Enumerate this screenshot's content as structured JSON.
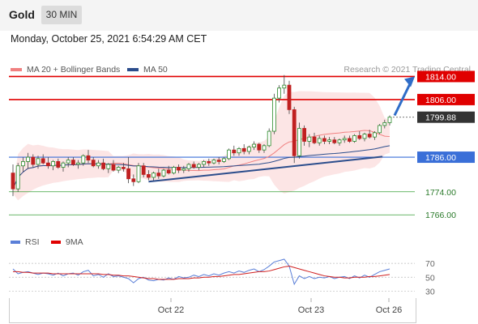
{
  "header": {
    "title": "Gold",
    "timeframe": "30 MIN"
  },
  "datetime": "Monday, October 25, 2021 6:54:29 AM CET",
  "legend": [
    {
      "label": "MA 20 + Bollinger Bands",
      "color": "#f08080"
    },
    {
      "label": "MA 50",
      "color": "#2b4d8c"
    }
  ],
  "credit": "Research © 2021 Trading Central",
  "colors": {
    "resistance": "#e00000",
    "support_blue": "#3a6fd8",
    "support_green": "#38a038",
    "candle_up": "#2a8a2a",
    "candle_down": "#c02020",
    "trend": "#2b4d8c",
    "last": "#333333"
  },
  "chart_data": {
    "type": "candlestick",
    "price_ylim": [
      1761,
      1822
    ],
    "levels": [
      {
        "value": 1814.0,
        "label": "1814.00",
        "kind": "resistance"
      },
      {
        "value": 1806.0,
        "label": "1806.00",
        "kind": "resistance"
      },
      {
        "value": 1799.88,
        "label": "1799.88",
        "kind": "last"
      },
      {
        "value": 1786.0,
        "label": "1786.00",
        "kind": "pivot"
      },
      {
        "value": 1774.0,
        "label": "1774.00",
        "kind": "support"
      },
      {
        "value": 1766.0,
        "label": "1766.00",
        "kind": "support"
      }
    ],
    "x_ticks": [
      "Oct 22",
      "Oct 23",
      "Oct 26"
    ],
    "candles": [
      [
        1780.5,
        1783.5,
        1772.5,
        1775.0
      ],
      [
        1775.0,
        1784.0,
        1774.0,
        1783.0
      ],
      [
        1783.0,
        1786.0,
        1781.0,
        1784.5
      ],
      [
        1784.5,
        1787.5,
        1782.0,
        1786.0
      ],
      [
        1786.0,
        1787.0,
        1782.5,
        1783.5
      ],
      [
        1783.5,
        1786.5,
        1782.0,
        1785.5
      ],
      [
        1785.5,
        1787.0,
        1783.5,
        1784.0
      ],
      [
        1784.0,
        1786.0,
        1782.0,
        1783.0
      ],
      [
        1783.0,
        1785.0,
        1781.5,
        1784.5
      ],
      [
        1784.5,
        1785.5,
        1782.0,
        1782.5
      ],
      [
        1782.5,
        1784.5,
        1781.0,
        1784.0
      ],
      [
        1784.0,
        1786.0,
        1782.5,
        1785.0
      ],
      [
        1785.0,
        1786.0,
        1783.0,
        1783.5
      ],
      [
        1783.5,
        1785.0,
        1782.0,
        1784.0
      ],
      [
        1784.0,
        1787.0,
        1783.0,
        1786.5
      ],
      [
        1786.5,
        1788.5,
        1784.0,
        1785.0
      ],
      [
        1785.0,
        1786.0,
        1782.5,
        1783.0
      ],
      [
        1783.0,
        1785.0,
        1782.0,
        1784.0
      ],
      [
        1784.0,
        1785.5,
        1781.5,
        1782.0
      ],
      [
        1782.0,
        1784.0,
        1780.5,
        1783.5
      ],
      [
        1783.5,
        1785.0,
        1781.0,
        1781.5
      ],
      [
        1781.5,
        1783.0,
        1780.5,
        1782.5
      ],
      [
        1782.5,
        1784.0,
        1781.0,
        1782.0
      ],
      [
        1782.0,
        1786.0,
        1777.0,
        1778.5
      ],
      [
        1778.5,
        1780.0,
        1776.0,
        1777.5
      ],
      [
        1777.5,
        1784.0,
        1777.0,
        1783.0
      ],
      [
        1783.0,
        1784.0,
        1779.0,
        1780.0
      ],
      [
        1780.0,
        1781.5,
        1778.0,
        1779.0
      ],
      [
        1779.0,
        1781.0,
        1777.5,
        1780.5
      ],
      [
        1780.5,
        1782.0,
        1778.5,
        1779.5
      ],
      [
        1779.5,
        1782.0,
        1779.0,
        1781.5
      ],
      [
        1781.5,
        1783.0,
        1780.0,
        1780.5
      ],
      [
        1780.5,
        1783.0,
        1780.0,
        1782.5
      ],
      [
        1782.5,
        1783.5,
        1780.5,
        1781.5
      ],
      [
        1781.5,
        1783.0,
        1780.5,
        1782.0
      ],
      [
        1782.0,
        1784.0,
        1781.0,
        1783.5
      ],
      [
        1783.5,
        1784.5,
        1782.0,
        1782.5
      ],
      [
        1782.5,
        1784.0,
        1781.5,
        1783.5
      ],
      [
        1783.5,
        1785.0,
        1782.5,
        1784.5
      ],
      [
        1784.5,
        1785.5,
        1783.0,
        1784.0
      ],
      [
        1784.0,
        1785.5,
        1783.5,
        1785.0
      ],
      [
        1785.0,
        1786.0,
        1783.5,
        1784.5
      ],
      [
        1784.5,
        1786.0,
        1784.0,
        1785.5
      ],
      [
        1785.5,
        1789.0,
        1785.0,
        1788.5
      ],
      [
        1788.5,
        1790.0,
        1786.5,
        1787.5
      ],
      [
        1787.5,
        1789.5,
        1786.5,
        1789.0
      ],
      [
        1789.0,
        1790.5,
        1787.0,
        1788.0
      ],
      [
        1788.0,
        1790.0,
        1787.0,
        1789.5
      ],
      [
        1789.5,
        1791.5,
        1788.5,
        1790.5
      ],
      [
        1790.5,
        1791.0,
        1787.5,
        1788.5
      ],
      [
        1788.5,
        1790.5,
        1787.5,
        1790.0
      ],
      [
        1790.0,
        1796.0,
        1789.5,
        1795.0
      ],
      [
        1795.0,
        1808.0,
        1794.0,
        1806.5
      ],
      [
        1806.5,
        1811.0,
        1805.0,
        1810.0
      ],
      [
        1810.0,
        1814.5,
        1808.0,
        1811.0
      ],
      [
        1811.0,
        1812.5,
        1801.0,
        1802.5
      ],
      [
        1802.5,
        1803.5,
        1784.0,
        1786.5
      ],
      [
        1786.5,
        1798.0,
        1785.5,
        1796.0
      ],
      [
        1796.0,
        1797.0,
        1790.0,
        1791.5
      ],
      [
        1791.5,
        1794.0,
        1789.5,
        1793.0
      ],
      [
        1793.0,
        1794.5,
        1790.5,
        1791.0
      ],
      [
        1791.0,
        1793.5,
        1790.0,
        1792.5
      ],
      [
        1792.5,
        1793.5,
        1790.5,
        1791.5
      ],
      [
        1791.5,
        1793.0,
        1790.5,
        1792.0
      ],
      [
        1792.0,
        1793.0,
        1790.5,
        1791.0
      ],
      [
        1791.0,
        1792.5,
        1790.0,
        1792.0
      ],
      [
        1792.0,
        1793.5,
        1791.0,
        1792.5
      ],
      [
        1792.5,
        1793.5,
        1791.0,
        1791.5
      ],
      [
        1791.5,
        1794.0,
        1791.0,
        1793.5
      ],
      [
        1793.5,
        1795.0,
        1792.0,
        1792.5
      ],
      [
        1792.5,
        1794.5,
        1791.5,
        1794.0
      ],
      [
        1794.0,
        1795.5,
        1792.5,
        1793.0
      ],
      [
        1793.0,
        1795.0,
        1792.0,
        1794.5
      ],
      [
        1794.5,
        1797.5,
        1794.0,
        1797.0
      ],
      [
        1797.0,
        1799.0,
        1796.0,
        1798.0
      ],
      [
        1798.0,
        1800.5,
        1797.0,
        1799.88
      ]
    ],
    "rsi": {
      "label": "RSI",
      "ma_label": "9MA",
      "ylim": [
        20,
        90
      ],
      "ticks": [
        70,
        50,
        30
      ],
      "values": [
        62,
        55,
        57,
        58,
        56,
        54,
        56,
        55,
        53,
        56,
        52,
        55,
        56,
        53,
        58,
        60,
        52,
        54,
        50,
        55,
        51,
        52,
        50,
        48,
        42,
        48,
        50,
        46,
        45,
        47,
        46,
        49,
        47,
        51,
        49,
        50,
        53,
        51,
        54,
        52,
        55,
        53,
        56,
        58,
        56,
        59,
        57,
        60,
        62,
        58,
        61,
        66,
        72,
        74,
        76,
        66,
        40,
        52,
        48,
        51,
        48,
        50,
        49,
        51,
        48,
        50,
        51,
        48,
        52,
        49,
        53,
        50,
        54,
        58,
        60,
        62
      ],
      "ma": [
        58,
        58,
        57,
        57,
        56,
        56,
        56,
        56,
        55,
        55,
        55,
        55,
        55,
        55,
        55,
        55,
        55,
        55,
        54,
        54,
        53,
        53,
        52,
        52,
        51,
        50,
        49,
        48,
        48,
        47,
        47,
        47,
        47,
        48,
        48,
        48,
        49,
        49,
        50,
        50,
        51,
        51,
        52,
        53,
        54,
        54,
        55,
        56,
        57,
        58,
        58,
        59,
        61,
        63,
        65,
        66,
        64,
        62,
        60,
        58,
        56,
        54,
        52,
        51,
        50,
        50,
        49,
        49,
        50,
        50,
        50,
        51,
        51,
        52,
        53,
        54
      ]
    }
  }
}
